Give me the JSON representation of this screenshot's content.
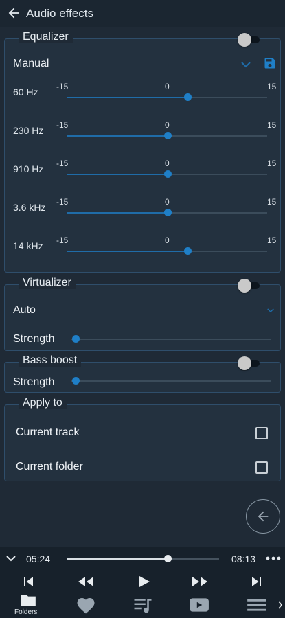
{
  "header": {
    "title": "Audio effects"
  },
  "equalizer": {
    "title": "Equalizer",
    "enabled": false,
    "preset": "Manual",
    "scale": {
      "min": "-15",
      "mid": "0",
      "max": "15"
    },
    "bands": [
      {
        "label": "60 Hz",
        "value": 3
      },
      {
        "label": "230 Hz",
        "value": 0
      },
      {
        "label": "910 Hz",
        "value": 0
      },
      {
        "label": "3.6 kHz",
        "value": 0
      },
      {
        "label": "14 kHz",
        "value": 3
      }
    ]
  },
  "virtualizer": {
    "title": "Virtualizer",
    "enabled": false,
    "mode": "Auto",
    "strength_label": "Strength",
    "strength": 0
  },
  "bass_boost": {
    "title": "Bass boost",
    "enabled": false,
    "strength_label": "Strength",
    "strength": 0
  },
  "apply_to": {
    "title": "Apply to",
    "items": [
      {
        "label": "Current track",
        "checked": false
      },
      {
        "label": "Current folder",
        "checked": false
      }
    ]
  },
  "player": {
    "elapsed": "05:24",
    "total": "08:13",
    "progress": 0.66
  },
  "bottom_nav": {
    "folders_label": "Folders"
  },
  "colors": {
    "accent": "#1f7fc7",
    "background": "#1f2a36",
    "panel": "#23313f",
    "border": "#2f4e6b"
  }
}
